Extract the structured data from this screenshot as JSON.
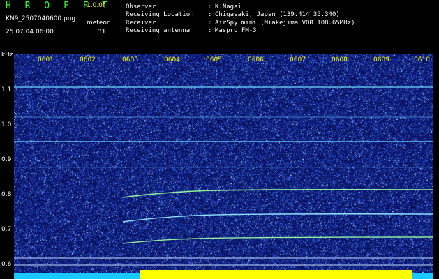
{
  "header": {
    "app_title": "H R O F F T",
    "version": "1.0.0f",
    "filename": "KN9_2507040600.png",
    "meteor_label": "meteor",
    "timestamp": "25.07.04 06:00",
    "meteor_count": "31"
  },
  "info": [
    {
      "label": "Observer",
      "value": "K.Nagai"
    },
    {
      "label": "Receiving Location",
      "value": "Chigasaki, Japan (139.414 35.340)"
    },
    {
      "label": "Receiver",
      "value": "AirSpy mini (Miakejima VOR 108.65MHz)"
    },
    {
      "label": "Receiving antenna",
      "value": "Maspro FM-3"
    }
  ],
  "axis": {
    "y_unit": "kHz",
    "y_ticks": [
      "1.1",
      "1.0",
      "0.9",
      "0.8",
      "0.7",
      "0.6"
    ],
    "x_ticks": [
      "0601",
      "0602",
      "0603",
      "0604",
      "0605",
      "0606",
      "0607",
      "0608",
      "0609",
      "0610"
    ]
  },
  "colors": {
    "background": "#0a1360",
    "signal": "#6fd8ff",
    "axis_text": "#ffff00",
    "bottom_band_cyan": "#18c8ff",
    "bottom_band_yellow": "#ffff00"
  }
}
